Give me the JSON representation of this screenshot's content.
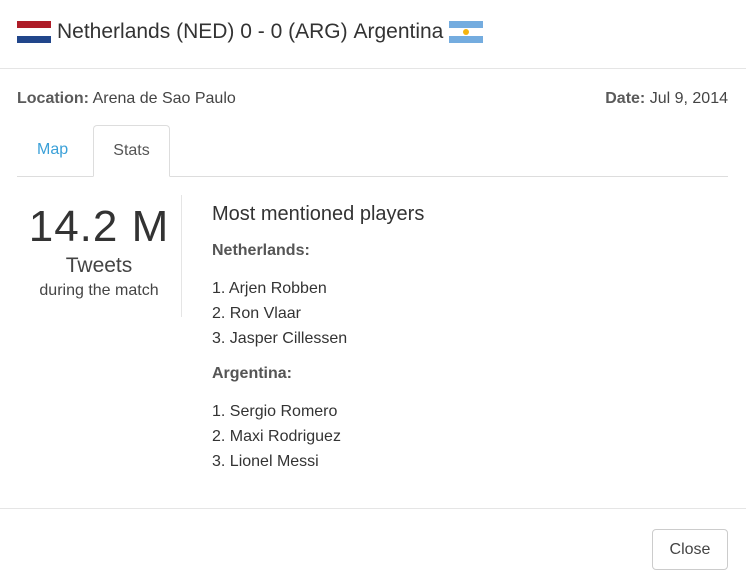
{
  "header": {
    "home_team": "Netherlands",
    "home_code": "(NED)",
    "score": "0 - 0",
    "away_code": "(ARG)",
    "away_team": "Argentina",
    "flags": {
      "netherlands": [
        "#ae1c28",
        "#ffffff",
        "#21468b"
      ],
      "argentina": [
        "#74acdf",
        "#ffffff",
        "#74acdf"
      ],
      "sun": "#f6b40e"
    }
  },
  "meta": {
    "location_label": "Location:",
    "location_value": "Arena de Sao Paulo",
    "date_label": "Date:",
    "date_value": "Jul 9, 2014"
  },
  "tabs": [
    {
      "label": "Map",
      "active": false
    },
    {
      "label": "Stats",
      "active": true
    }
  ],
  "tweets": {
    "count": "14.2 M",
    "label": "Tweets",
    "sublabel": "during the match"
  },
  "players": {
    "title": "Most mentioned players",
    "teams": [
      {
        "name": "Netherlands:",
        "list": [
          "1. Arjen Robben",
          "2. Ron Vlaar",
          "3. Jasper Cillessen"
        ]
      },
      {
        "name": "Argentina:",
        "list": [
          "1. Sergio Romero",
          "2. Maxi Rodriguez",
          "3. Lionel Messi"
        ]
      }
    ]
  },
  "footer": {
    "close_label": "Close"
  },
  "colors": {
    "link": "#3aa0d8",
    "border": "#dddddd"
  }
}
